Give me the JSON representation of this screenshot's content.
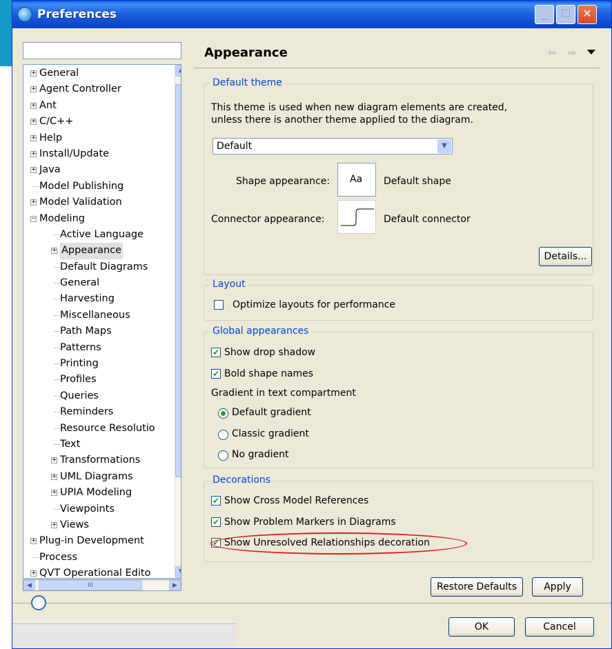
{
  "window": {
    "title": "Preferences",
    "controls": {
      "minimize": "_",
      "maximize": "☐",
      "close": "✕"
    }
  },
  "filter": {
    "value": ""
  },
  "tree": {
    "items": [
      {
        "label": "General",
        "expandable": true,
        "expanded": false,
        "level": 0
      },
      {
        "label": "Agent Controller",
        "expandable": true,
        "expanded": false,
        "level": 0
      },
      {
        "label": "Ant",
        "expandable": true,
        "expanded": false,
        "level": 0
      },
      {
        "label": "C/C++",
        "expandable": true,
        "expanded": false,
        "level": 0
      },
      {
        "label": "Help",
        "expandable": true,
        "expanded": false,
        "level": 0
      },
      {
        "label": "Install/Update",
        "expandable": true,
        "expanded": false,
        "level": 0
      },
      {
        "label": "Java",
        "expandable": true,
        "expanded": false,
        "level": 0
      },
      {
        "label": "Model Publishing",
        "expandable": false,
        "level": 0
      },
      {
        "label": "Model Validation",
        "expandable": true,
        "expanded": false,
        "level": 0
      },
      {
        "label": "Modeling",
        "expandable": true,
        "expanded": true,
        "level": 0
      },
      {
        "label": "Active Language",
        "expandable": false,
        "level": 1
      },
      {
        "label": "Appearance",
        "expandable": true,
        "expanded": false,
        "level": 1,
        "selected": true
      },
      {
        "label": "Default Diagrams",
        "expandable": false,
        "level": 1
      },
      {
        "label": "General",
        "expandable": false,
        "level": 1
      },
      {
        "label": "Harvesting",
        "expandable": false,
        "level": 1
      },
      {
        "label": "Miscellaneous",
        "expandable": false,
        "level": 1
      },
      {
        "label": "Path Maps",
        "expandable": false,
        "level": 1
      },
      {
        "label": "Patterns",
        "expandable": false,
        "level": 1
      },
      {
        "label": "Printing",
        "expandable": false,
        "level": 1
      },
      {
        "label": "Profiles",
        "expandable": false,
        "level": 1
      },
      {
        "label": "Queries",
        "expandable": false,
        "level": 1
      },
      {
        "label": "Reminders",
        "expandable": false,
        "level": 1
      },
      {
        "label": "Resource Resolutio",
        "expandable": false,
        "level": 1
      },
      {
        "label": "Text",
        "expandable": false,
        "level": 1
      },
      {
        "label": "Transformations",
        "expandable": true,
        "expanded": false,
        "level": 1
      },
      {
        "label": "UML Diagrams",
        "expandable": true,
        "expanded": false,
        "level": 1
      },
      {
        "label": "UPIA Modeling",
        "expandable": true,
        "expanded": false,
        "level": 1
      },
      {
        "label": "Viewpoints",
        "expandable": false,
        "level": 1
      },
      {
        "label": "Views",
        "expandable": true,
        "expanded": false,
        "level": 1
      },
      {
        "label": "Plug-in Development",
        "expandable": true,
        "expanded": false,
        "level": 0
      },
      {
        "label": "Process",
        "expandable": false,
        "level": 0
      },
      {
        "label": "QVT Operational Edito",
        "expandable": true,
        "expanded": false,
        "level": 0
      }
    ]
  },
  "page": {
    "heading": "Appearance",
    "nav": {
      "back": "⇦",
      "forward": "⇨",
      "dropdown": "▾"
    },
    "default_theme": {
      "title": "Default theme",
      "description_line1": "This theme is used when new diagram elements are created,",
      "description_line2": "unless there is another theme applied to the diagram.",
      "theme_value": "Default",
      "shape_label": "Shape appearance:",
      "shape_preview": "Aa",
      "shape_value": "Default shape",
      "connector_label": "Connector appearance:",
      "connector_value": "Default connector",
      "details_button": "Details..."
    },
    "layout": {
      "title": "Layout",
      "optimize_label": "Optimize layouts for performance",
      "optimize_checked": false
    },
    "global": {
      "title": "Global appearances",
      "drop_shadow_label": "Show drop shadow",
      "drop_shadow_checked": true,
      "bold_names_label": "Bold shape names",
      "bold_names_checked": true,
      "gradient_label": "Gradient in text compartment",
      "gradient_options": [
        "Default gradient",
        "Classic gradient",
        "No gradient"
      ],
      "gradient_selected": "Default gradient"
    },
    "decorations": {
      "title": "Decorations",
      "cross_model_label": "Show Cross Model References",
      "problem_markers_label": "Show Problem Markers in Diagrams",
      "unresolved_label": "Show Unresolved Relationships decoration",
      "all_checked": true
    },
    "restore_defaults": "Restore Defaults",
    "apply": "Apply"
  },
  "footer": {
    "ok": "OK",
    "cancel": "Cancel"
  },
  "colors": {
    "accent_edge": "#1599c9",
    "group_title": "#0046d5",
    "annotation": "#d81f1f",
    "check": "#21a121"
  }
}
